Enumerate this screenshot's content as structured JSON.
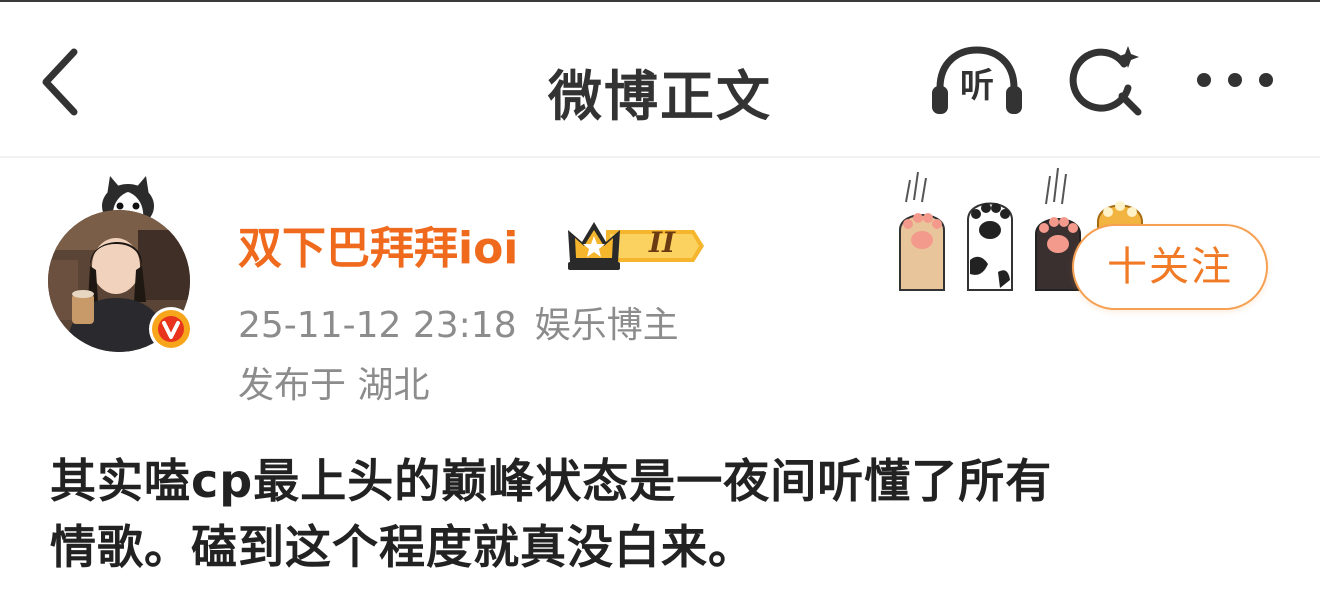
{
  "nav": {
    "title": "微博正文",
    "listen_label": "听"
  },
  "author": {
    "name": "双下巴拜拜ioi",
    "badge_level": "II",
    "time": "25-11-12 23:18",
    "role": "娱乐博主",
    "location": "发布于 湖北"
  },
  "follow": {
    "label": "十关注"
  },
  "post": {
    "line1": "其实嗑cp最上头的巅峰状态是一夜间听懂了所有",
    "line2": "情歌。磕到这个程度就真没白来。"
  },
  "colors": {
    "accent": "#f06a1e",
    "meta": "#8c8c8c",
    "follow_border": "#f5a052"
  }
}
